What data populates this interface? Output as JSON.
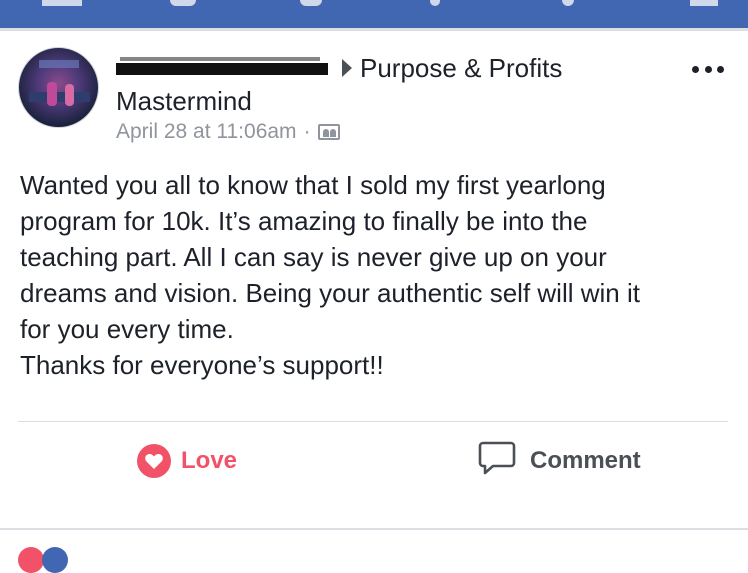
{
  "post": {
    "author_redacted": "",
    "group_name_line1": "Purpose & Profits",
    "group_name_line2": "Mastermind",
    "timestamp": "April 28 at 11:06am",
    "separator": "·",
    "body": "Wanted you all to know that I sold my first yearlong\nprogram for 10k. It’s amazing to finally be into the\nteaching part. All I can say is never give up on your\ndreams and vision. Being your authentic self will win it\nfor you every time.\nThanks for everyone’s support!!"
  },
  "actions": {
    "love_label": "Love",
    "comment_label": "Comment"
  },
  "icons": {
    "more": "more-options-icon",
    "audience": "group-audience-icon",
    "love": "heart-icon",
    "comment": "comment-bubble-icon"
  },
  "colors": {
    "topbar": "#4267b2",
    "love_red": "#f25268",
    "meta_gray": "#90949c",
    "text": "#1d2129"
  }
}
